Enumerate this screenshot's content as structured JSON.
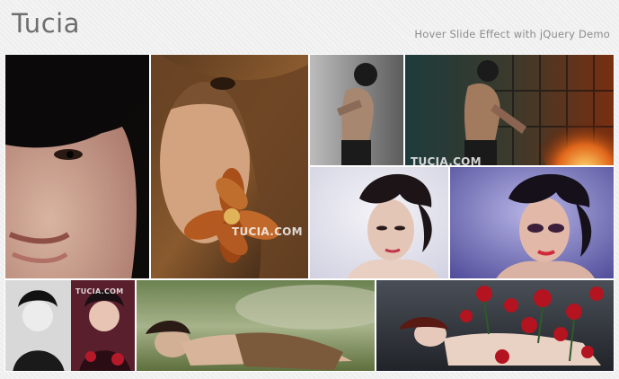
{
  "header": {
    "logo": "Tucia",
    "subtitle": "Hover Slide Effect with jQuery Demo"
  },
  "watermark": "TUCIA.COM",
  "tiles": [
    {
      "name": "photo-tile-1",
      "description": "close-up portrait with black bangs"
    },
    {
      "name": "photo-tile-2",
      "description": "portrait holding orange flower"
    },
    {
      "name": "photo-tile-3",
      "description": "figure posing against grey backdrop"
    },
    {
      "name": "photo-tile-4",
      "description": "figure posing in front of fire"
    },
    {
      "name": "photo-tile-5",
      "description": "short hair portrait, natural light"
    },
    {
      "name": "photo-tile-6",
      "description": "short hair portrait, dramatic purple makeup"
    },
    {
      "name": "photo-tile-7",
      "description": "before and after black and white with roses"
    },
    {
      "name": "photo-tile-8",
      "description": "woman lying in grass"
    },
    {
      "name": "photo-tile-9",
      "description": "woman lying among red roses"
    }
  ]
}
